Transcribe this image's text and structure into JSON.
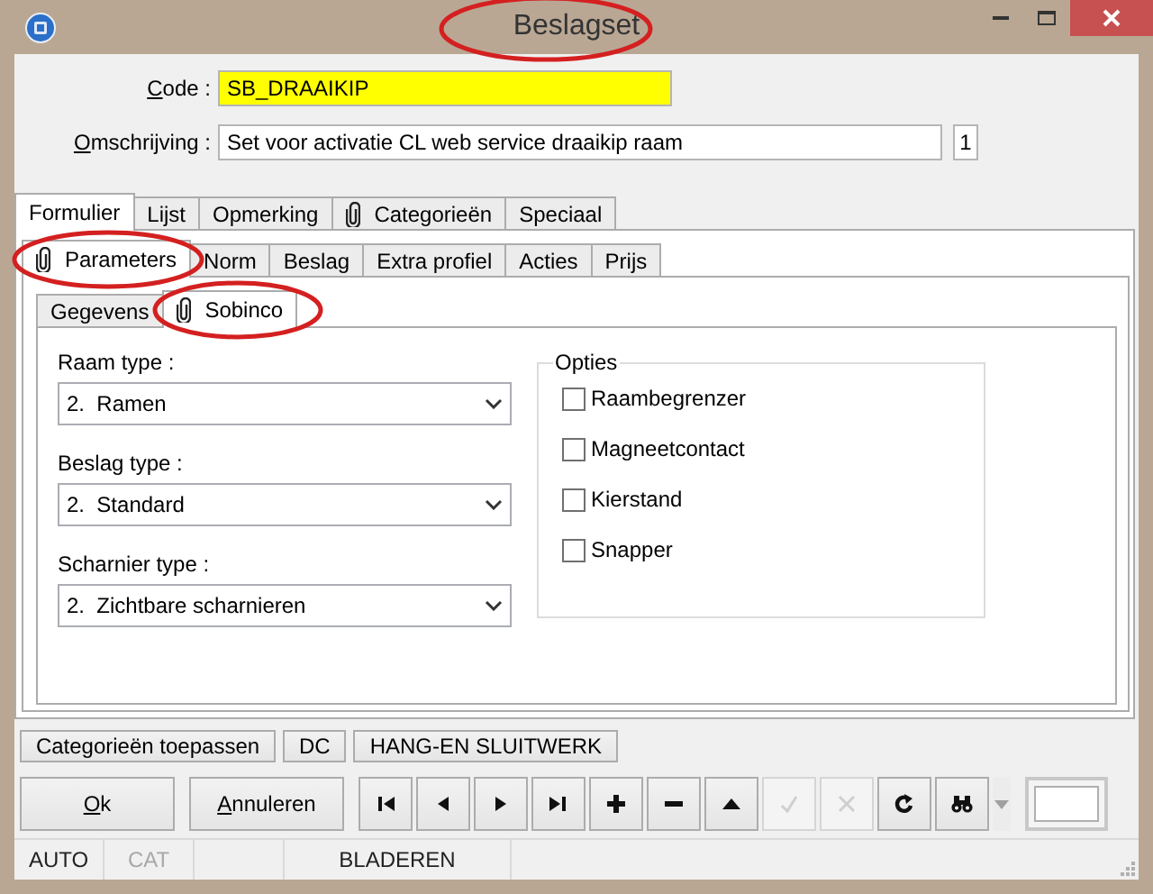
{
  "window": {
    "title": "Beslagset",
    "title_circled": true
  },
  "fields": [
    {
      "accel": "C",
      "label": "ode :",
      "value": "SB_DRAAIKIP",
      "color": "#ffff00"
    },
    {
      "accel": "O",
      "label": "mschrijving :",
      "value": "Set voor activatie CL web service draaikip raam",
      "color": "#ffffff",
      "counter": "1"
    }
  ],
  "tabs": [
    {
      "label": "Formulier",
      "selected": true,
      "attachment": false
    },
    {
      "label": "Lijst",
      "selected": false,
      "attachment": false
    },
    {
      "label": "Opmerking",
      "selected": false,
      "attachment": false
    },
    {
      "label": "Categorieën",
      "selected": false,
      "attachment": true
    },
    {
      "label": "Speciaal",
      "selected": false,
      "attachment": false
    }
  ],
  "subtabs": [
    {
      "label": "Parameters",
      "selected": true,
      "attachment": true,
      "circled": true
    },
    {
      "label": "Norm",
      "selected": false,
      "attachment": false,
      "circled": false
    },
    {
      "label": "Beslag",
      "selected": false,
      "attachment": false,
      "circled": false
    },
    {
      "label": "Extra profiel",
      "selected": false,
      "attachment": false,
      "circled": false
    },
    {
      "label": "Acties",
      "selected": false,
      "attachment": false,
      "circled": false
    },
    {
      "label": "Prijs",
      "selected": false,
      "attachment": false,
      "circled": false
    }
  ],
  "inner_tabs": [
    {
      "label": "Gegevens",
      "selected": false,
      "attachment": false,
      "circled": false
    },
    {
      "label": "Sobinco",
      "selected": true,
      "attachment": true,
      "circled": true
    }
  ],
  "selects": [
    {
      "label": "Raam type :",
      "value": "2.  Ramen"
    },
    {
      "label": "Beslag type :",
      "value": "2.  Standard"
    },
    {
      "label": "Scharnier type :",
      "value": "2.  Zichtbare scharnieren"
    }
  ],
  "options": {
    "title": "Opties",
    "items": [
      {
        "label": "Raambegrenzer",
        "checked": false
      },
      {
        "label": "Magneetcontact",
        "checked": false
      },
      {
        "label": "Kierstand",
        "checked": false
      },
      {
        "label": "Snapper",
        "checked": false
      }
    ]
  },
  "action_buttons": [
    "Categorieën toepassen",
    "DC",
    "HANG-EN SLUITWERK"
  ],
  "dialog_buttons": [
    {
      "accel": "O",
      "label": "k"
    },
    {
      "accel": "A",
      "label": "nnuleren"
    }
  ],
  "toolbar": [
    {
      "kind": "first",
      "disabled": false
    },
    {
      "kind": "prev",
      "disabled": false
    },
    {
      "kind": "next",
      "disabled": false
    },
    {
      "kind": "last",
      "disabled": false
    },
    {
      "kind": "add",
      "disabled": false
    },
    {
      "kind": "remove",
      "disabled": false
    },
    {
      "kind": "up",
      "disabled": false
    },
    {
      "kind": "confirm",
      "disabled": true
    },
    {
      "kind": "cancel",
      "disabled": true
    },
    {
      "kind": "refresh",
      "disabled": false
    },
    {
      "kind": "find",
      "disabled": false
    }
  ],
  "status_bar": [
    {
      "kind": "text",
      "text": "AUTO",
      "disabled": false
    },
    {
      "kind": "text",
      "text": "CAT",
      "disabled": true
    },
    {
      "kind": "blank"
    },
    {
      "kind": "text",
      "text": "BLADEREN",
      "disabled": false
    }
  ]
}
